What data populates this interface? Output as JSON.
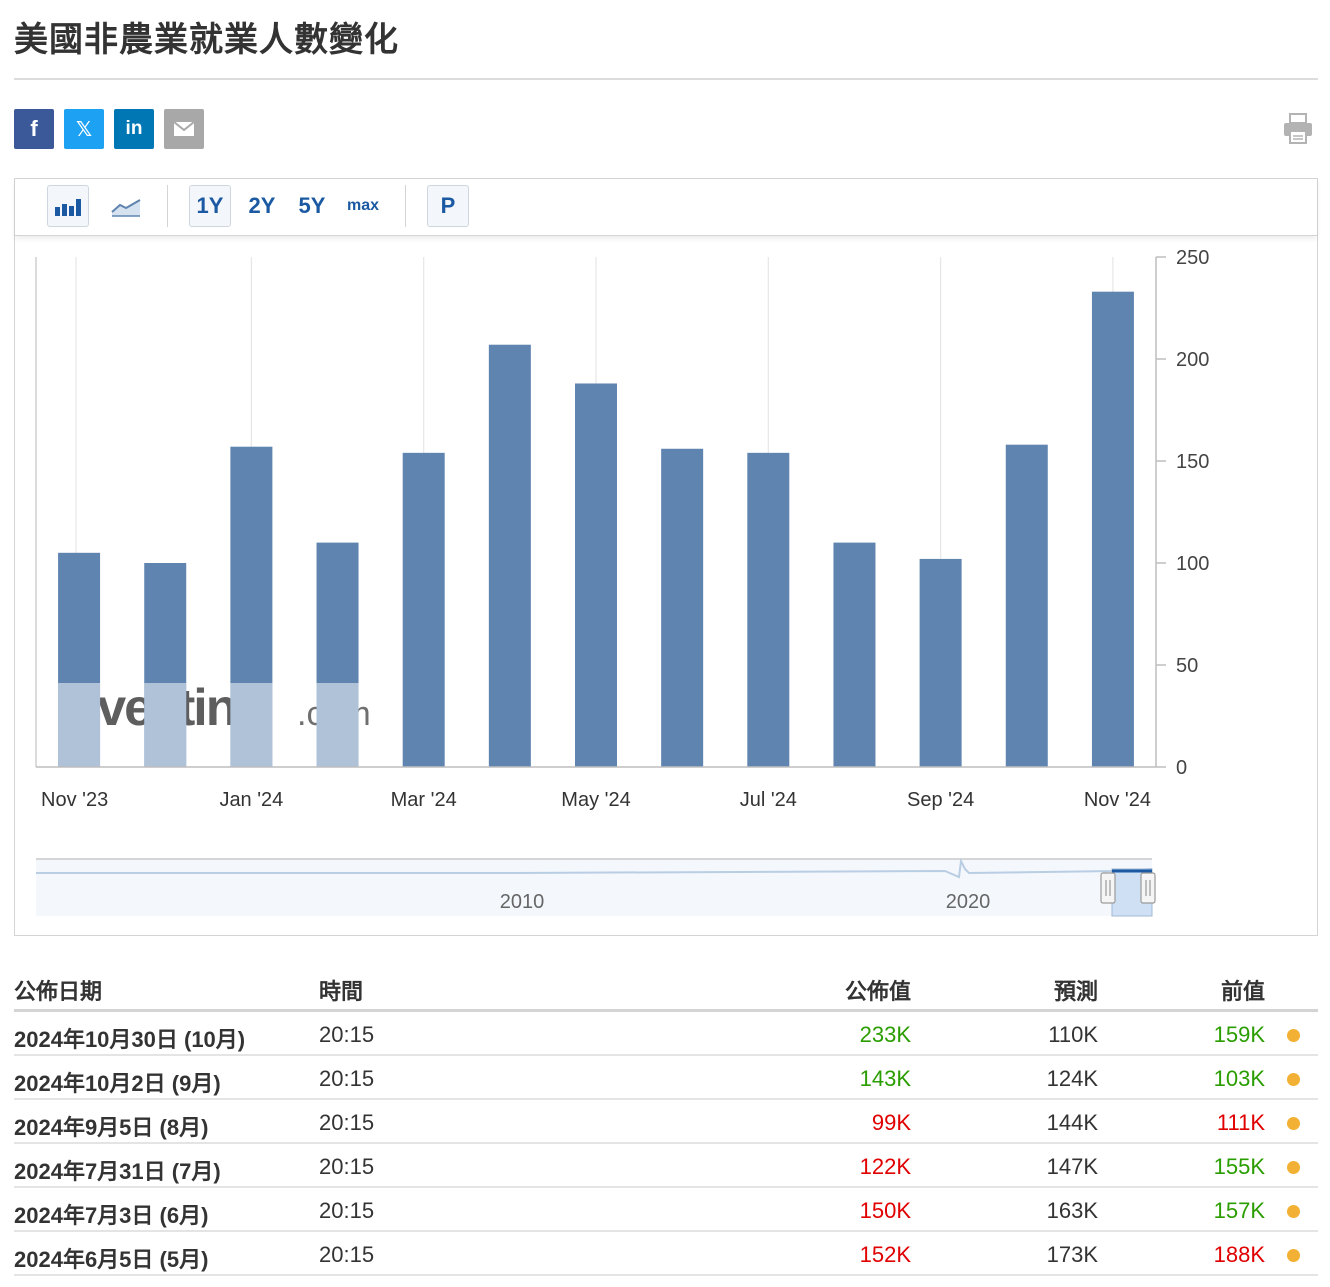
{
  "page": {
    "title": "美國非農業就業人數變化"
  },
  "share": {
    "facebook_icon": "f",
    "twitter_icon": "𝕏",
    "linkedin_icon": "in"
  },
  "toolbar": {
    "range_1y": "1Y",
    "range_2y": "2Y",
    "range_5y": "5Y",
    "range_max": "max",
    "p_button": "P",
    "selected_range": "1Y",
    "selected_type": "bar"
  },
  "chart_data": {
    "type": "bar",
    "categories": [
      "Nov '23",
      "Dec '23",
      "Jan '24",
      "Feb '24",
      "Mar '24",
      "Apr '24",
      "May '24",
      "Jun '24",
      "Jul '24",
      "Aug '24",
      "Sep '24",
      "Oct '24",
      "Nov '24"
    ],
    "x_tick_labels": [
      "Nov '23",
      "Jan '24",
      "Mar '24",
      "May '24",
      "Jul '24",
      "Sep '24",
      "Nov '24"
    ],
    "values": [
      105,
      100,
      157,
      110,
      154,
      207,
      188,
      156,
      154,
      110,
      102,
      158,
      233
    ],
    "y_ticks": [
      0,
      50,
      100,
      150,
      200,
      250
    ],
    "ylim": [
      0,
      250
    ],
    "bar_color": "#5f84b0",
    "grid": "vertical",
    "y_axis_side": "right",
    "watermark": "Investing.com",
    "navigator_labels": [
      "2010",
      "2020"
    ]
  },
  "table": {
    "headers": {
      "date": "公佈日期",
      "time": "時間",
      "actual": "公佈值",
      "forecast": "預測",
      "previous": "前值"
    },
    "rows": [
      {
        "date": "2024年10月30日 (10月)",
        "time": "20:15",
        "actual": "233K",
        "actual_color": "#2a9d00",
        "forecast": "110K",
        "previous": "159K",
        "previous_color": "#2a9d00"
      },
      {
        "date": "2024年10月2日 (9月)",
        "time": "20:15",
        "actual": "143K",
        "actual_color": "#2a9d00",
        "forecast": "124K",
        "previous": "103K",
        "previous_color": "#2a9d00"
      },
      {
        "date": "2024年9月5日 (8月)",
        "time": "20:15",
        "actual": "99K",
        "actual_color": "#e00000",
        "forecast": "144K",
        "previous": "111K",
        "previous_color": "#e00000"
      },
      {
        "date": "2024年7月31日 (7月)",
        "time": "20:15",
        "actual": "122K",
        "actual_color": "#e00000",
        "forecast": "147K",
        "previous": "155K",
        "previous_color": "#2a9d00"
      },
      {
        "date": "2024年7月3日 (6月)",
        "time": "20:15",
        "actual": "150K",
        "actual_color": "#e00000",
        "forecast": "163K",
        "previous": "157K",
        "previous_color": "#2a9d00"
      },
      {
        "date": "2024年6月5日 (5月)",
        "time": "20:15",
        "actual": "152K",
        "actual_color": "#e00000",
        "forecast": "173K",
        "previous": "188K",
        "previous_color": "#e00000"
      }
    ],
    "status_dot_color": "#f2b134"
  }
}
